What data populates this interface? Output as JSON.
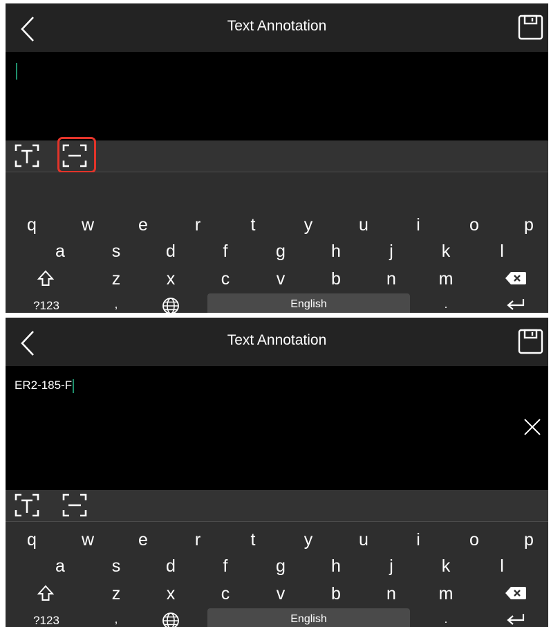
{
  "screens": [
    {
      "header": {
        "title": "Text Annotation"
      },
      "input": {
        "text": ""
      },
      "keyboard": {
        "row1": [
          "q",
          "w",
          "e",
          "r",
          "t",
          "y",
          "u",
          "i",
          "o",
          "p"
        ],
        "row2": [
          "a",
          "s",
          "d",
          "f",
          "g",
          "h",
          "j",
          "k",
          "l"
        ],
        "row3": [
          "z",
          "x",
          "c",
          "v",
          "b",
          "n",
          "m"
        ],
        "symbols": "?123",
        "comma": ",",
        "space": "English",
        "period": "."
      }
    },
    {
      "header": {
        "title": "Text Annotation"
      },
      "input": {
        "text": "ER2-185-F"
      },
      "keyboard": {
        "row1": [
          "q",
          "w",
          "e",
          "r",
          "t",
          "y",
          "u",
          "i",
          "o",
          "p"
        ],
        "row2": [
          "a",
          "s",
          "d",
          "f",
          "g",
          "h",
          "j",
          "k",
          "l"
        ],
        "row3": [
          "z",
          "x",
          "c",
          "v",
          "b",
          "n",
          "m"
        ],
        "symbols": "?123",
        "comma": ",",
        "space": "English",
        "period": "."
      }
    }
  ],
  "icons": {
    "back": "chevron-left-icon",
    "save": "floppy-save-icon",
    "text_mode": "text-scan-icon",
    "line_mode": "line-scan-icon",
    "clear": "close-icon",
    "shift": "shift-arrow-icon",
    "backspace": "backspace-icon",
    "language": "globe-icon",
    "enter": "enter-arrow-icon"
  },
  "colors": {
    "highlight": "#e3342a",
    "cursor": "#1f8f6c"
  }
}
